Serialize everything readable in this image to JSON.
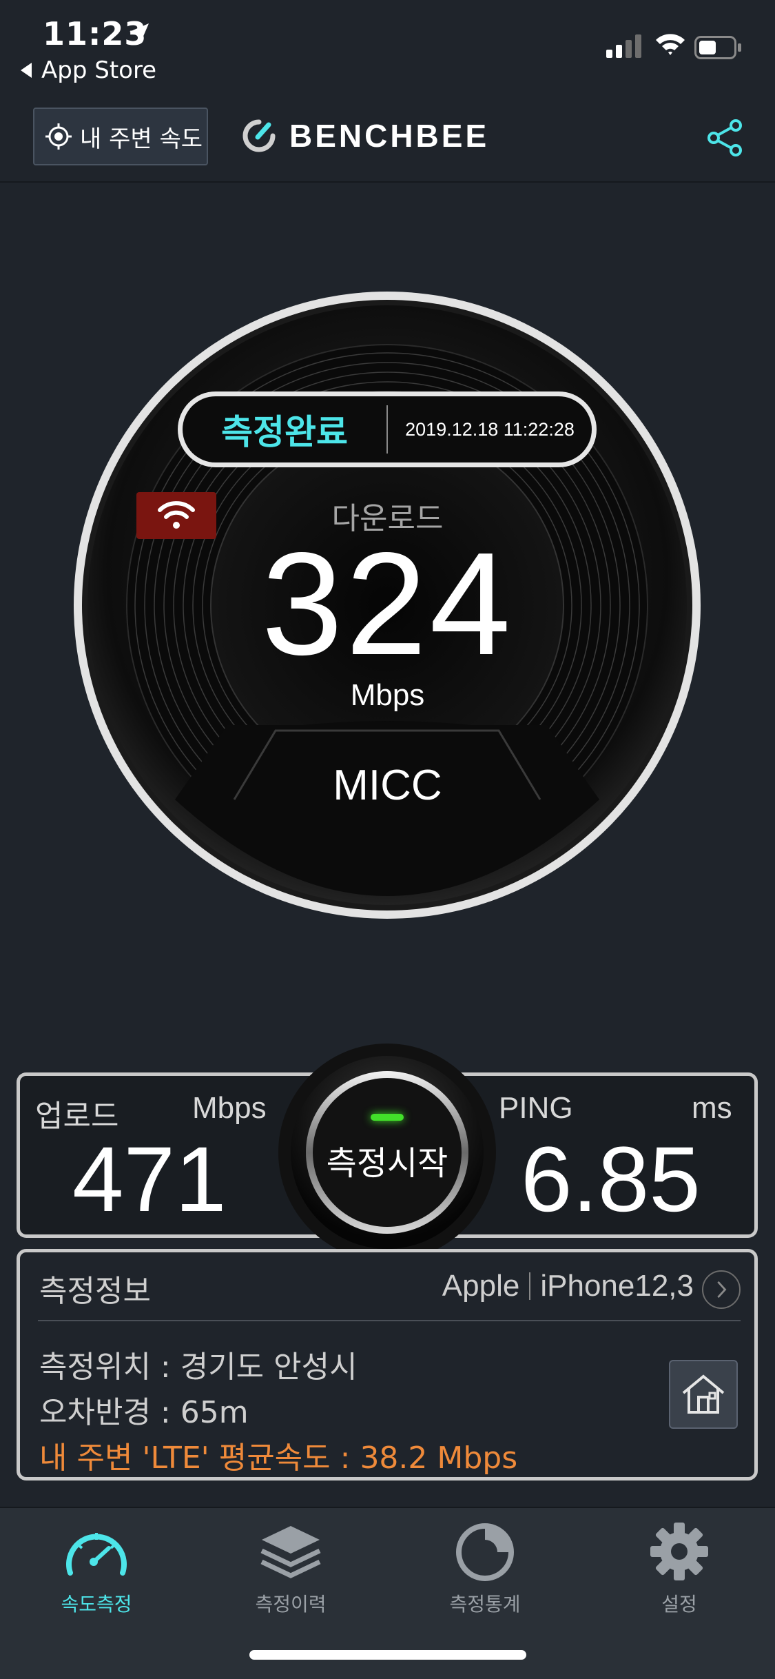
{
  "status_bar": {
    "time": "11:23",
    "back_app": "App Store"
  },
  "header": {
    "nearby_button": "내 주변 속도",
    "brand": "BENCHBEE",
    "share_icon": "share-icon"
  },
  "gauge": {
    "status": "측정완료",
    "timestamp": "2019.12.18 11:22:28",
    "connection_icon": "wifi-icon",
    "download_label": "다운로드",
    "download_value": "324",
    "download_unit": "Mbps",
    "carrier": "MICC"
  },
  "stats": {
    "upload_label": "업로드",
    "upload_unit": "Mbps",
    "upload_value": "471",
    "ping_label": "PING",
    "ping_unit": "ms",
    "ping_value": "6.85",
    "start_button": "측정시작"
  },
  "info": {
    "title": "측정정보",
    "device_brand": "Apple",
    "device_model": "iPhone12,3",
    "location": "측정위치 : 경기도 안성시",
    "error_radius": "오차반경 : 65m",
    "nearby_average": "내 주변 'LTE' 평균속도 : 38.2 Mbps"
  },
  "tabs": [
    {
      "label": "속도측정",
      "icon": "speedometer-icon",
      "active": true
    },
    {
      "label": "측정이력",
      "icon": "layers-icon",
      "active": false
    },
    {
      "label": "측정통계",
      "icon": "stats-icon",
      "active": false
    },
    {
      "label": "설정",
      "icon": "gear-icon",
      "active": false
    }
  ],
  "colors": {
    "accent": "#4de5e9",
    "warning": "#ef8a3a",
    "background": "#1f242b",
    "led": "#42e02a"
  }
}
